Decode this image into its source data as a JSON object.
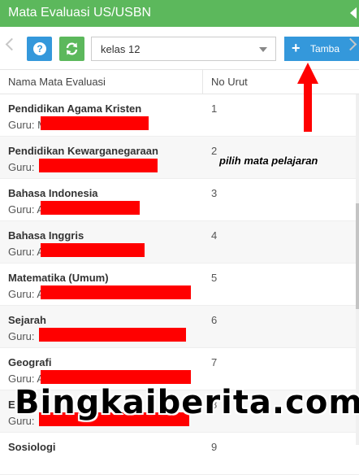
{
  "header": {
    "title": "Mata Evaluasi US/USBN",
    "collapse_icon": "caret-left-icon"
  },
  "toolbar": {
    "help_label": "?",
    "class_select": {
      "value": "kelas 12"
    },
    "add_button": {
      "plus": "+",
      "label": "Tamba"
    }
  },
  "table": {
    "columns": [
      "Nama Mata Evaluasi",
      "No Urut"
    ],
    "rows": [
      {
        "subject": "Pendidikan Agama Kristen",
        "teacher": "Guru: M",
        "number": "1"
      },
      {
        "subject": "Pendidikan Kewarganegaraan",
        "teacher": "Guru: ",
        "number": "2"
      },
      {
        "subject": "Bahasa Indonesia",
        "teacher": "Guru: A",
        "number": "3"
      },
      {
        "subject": "Bahasa Inggris",
        "teacher": "Guru: A",
        "number": "4"
      },
      {
        "subject": "Matematika (Umum)",
        "teacher": "Guru: A",
        "number": "5"
      },
      {
        "subject": "Sejarah",
        "teacher": "Guru: ",
        "number": "6"
      },
      {
        "subject": "Geografi",
        "teacher": "Guru: A",
        "number": "7"
      },
      {
        "subject": "E",
        "teacher": "Guru: ",
        "number": "8"
      },
      {
        "subject": "Sosiologi",
        "teacher": "",
        "number": "9"
      }
    ]
  },
  "annotation": "pilih mata pelajaran",
  "watermark": "Bingkaiberita.com",
  "colors": {
    "header": "#5cb85c",
    "button_blue": "#3498db",
    "button_green": "#5cb85c",
    "redaction": "#ff0000"
  }
}
